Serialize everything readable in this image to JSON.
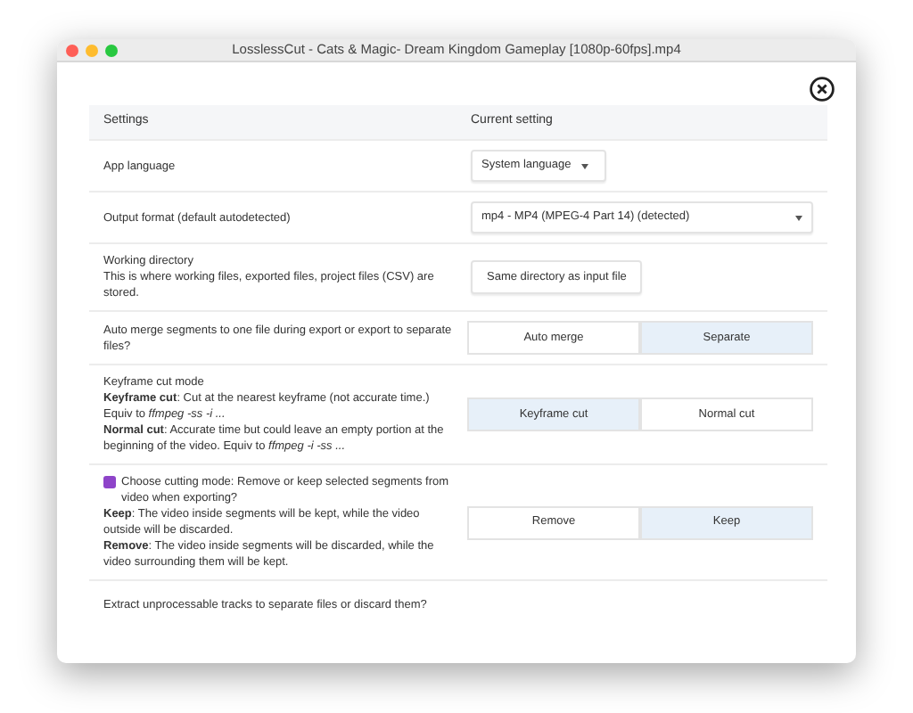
{
  "window": {
    "title": "LosslessCut - Cats & Magic- Dream Kingdom Gameplay [1080p-60fps].mp4"
  },
  "table": {
    "columns": [
      "Settings",
      "Current setting"
    ],
    "rows": [
      {
        "description": [
          "App language"
        ],
        "control": {
          "kind": "select",
          "value": "System language",
          "wide": false
        }
      },
      {
        "description": [
          "Output format (default autodetected)"
        ],
        "control": {
          "kind": "select",
          "value": "mp4 - MP4 (MPEG-4 Part 14) (detected)",
          "wide": true
        }
      },
      {
        "description": [
          "Working directory",
          "This is where working files, exported files, project files (CSV) are stored."
        ],
        "control": {
          "kind": "button",
          "label": "Same directory as input file"
        }
      },
      {
        "description": [
          "Auto merge segments to one file during export or export to separate files?"
        ],
        "control": {
          "kind": "segmented",
          "options": [
            {
              "label": "Auto merge",
              "selected": false
            },
            {
              "label": "Separate",
              "selected": true
            }
          ]
        }
      },
      {
        "description": [
          "Keyframe cut mode",
          "**Keyframe cut**: Cut at the nearest keyframe (not accurate time.) Equiv to *ffmpeg -ss -i ...*",
          "**Normal cut**: Accurate time but could leave an empty portion at the beginning of the video. Equiv to *ffmpeg -i -ss ...*"
        ],
        "control": {
          "kind": "segmented",
          "options": [
            {
              "label": "Keyframe cut",
              "selected": true
            },
            {
              "label": "Normal cut",
              "selected": false
            }
          ]
        }
      },
      {
        "icon": true,
        "description": [
          "Choose cutting mode: Remove or keep selected segments from video when exporting?",
          "**Keep**: The video inside segments will be kept, while the video outside will be discarded.",
          "**Remove**: The video inside segments will be discarded, while the video surrounding them will be kept."
        ],
        "control": {
          "kind": "segmented",
          "options": [
            {
              "label": "Remove",
              "selected": false
            },
            {
              "label": "Keep",
              "selected": true
            }
          ]
        }
      },
      {
        "description": [
          "Extract unprocessable tracks to separate files or discard them?"
        ]
      }
    ]
  }
}
